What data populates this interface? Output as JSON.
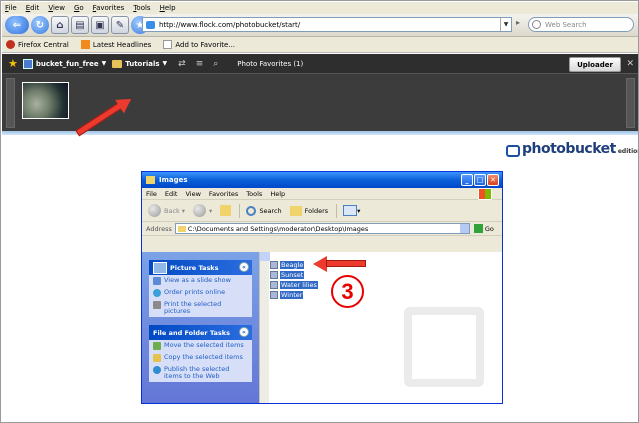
{
  "browser": {
    "menu": [
      "File",
      "Edit",
      "View",
      "Go",
      "Favorites",
      "Tools",
      "Help"
    ],
    "url": "http://www.flock.com/photobucket/start/",
    "search_placeholder": "Web Search",
    "bookmarks": [
      "Firefox Central",
      "Latest Headlines",
      "Add to Favorite..."
    ]
  },
  "photobar": {
    "account": "bucket_fun_free",
    "album": "Tutorials",
    "tab": "Photo Favorites (1)",
    "uploader_label": "Uploader"
  },
  "logo": {
    "name": "photobucket",
    "edition": "edition"
  },
  "explorer": {
    "title": "Images",
    "menu": [
      "File",
      "Edit",
      "View",
      "Favorites",
      "Tools",
      "Help"
    ],
    "toolbar": {
      "back": "Back",
      "search": "Search",
      "folders": "Folders"
    },
    "address_label": "Address",
    "address": "C:\\Documents and Settings\\moderator\\Desktop\\Images",
    "go": "Go",
    "picture_tasks": {
      "title": "Picture Tasks",
      "items": [
        "View as a slide show",
        "Order prints online",
        "Print the selected pictures"
      ]
    },
    "file_tasks": {
      "title": "File and Folder Tasks",
      "items": [
        "Move the selected items",
        "Copy the selected items",
        "Publish the selected items to the Web"
      ]
    },
    "files": [
      "Beagle",
      "Sunset",
      "Water lilies",
      "Winter"
    ]
  },
  "step_number": "3",
  "colors": {
    "arrow": "#ec3b2e",
    "highlight": "#316ac5",
    "step": "#e60000"
  }
}
